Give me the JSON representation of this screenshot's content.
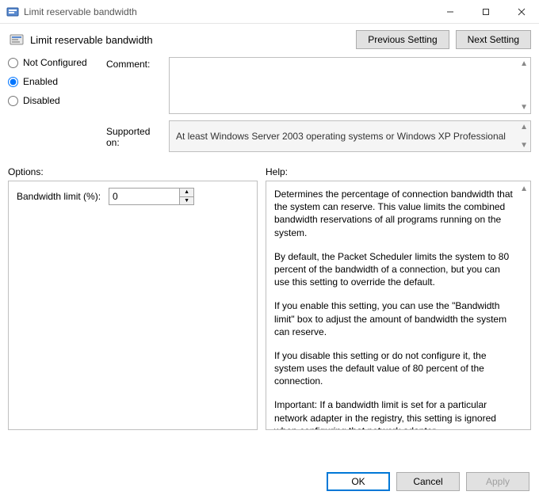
{
  "window": {
    "title": "Limit reservable bandwidth"
  },
  "header": {
    "policy_name": "Limit reservable bandwidth",
    "prev_btn": "Previous Setting",
    "next_btn": "Next Setting"
  },
  "state": {
    "not_configured": "Not Configured",
    "enabled": "Enabled",
    "disabled": "Disabled",
    "selected": "enabled"
  },
  "labels": {
    "comment": "Comment:",
    "supported_on": "Supported on:",
    "options": "Options:",
    "help": "Help:"
  },
  "comment": "",
  "supported_on": "At least Windows Server 2003 operating systems or Windows XP Professional",
  "options": {
    "bandwidth_label": "Bandwidth limit (%):",
    "bandwidth_value": "0"
  },
  "help_paragraphs": {
    "p1": "Determines the percentage of connection bandwidth that the system can reserve. This value limits the combined bandwidth reservations of all programs running on the system.",
    "p2": "By default, the Packet Scheduler limits the system to 80 percent of the bandwidth of a connection, but you can use this setting to override the default.",
    "p3": "If you enable this setting, you can use the \"Bandwidth limit\" box to adjust the amount of bandwidth the system can reserve.",
    "p4": "If you disable this setting or do not configure it, the system uses the default value of 80 percent of the connection.",
    "p5": "Important: If a bandwidth limit is set for a particular network adapter in the registry, this setting is ignored when configuring that network adapter."
  },
  "footer": {
    "ok": "OK",
    "cancel": "Cancel",
    "apply": "Apply"
  }
}
